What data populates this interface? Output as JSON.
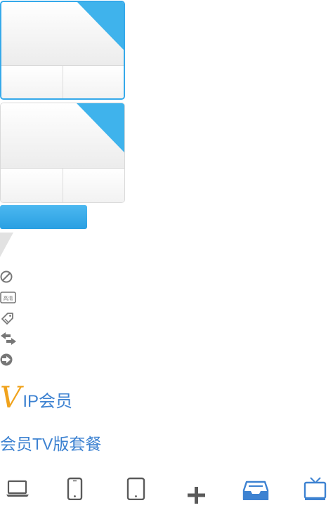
{
  "plans": {
    "cards": [
      {
        "state": "selected"
      },
      {
        "state": "default"
      }
    ],
    "accent_color": "#35a9ea"
  },
  "pay_button": {
    "color": "#2a9fe2"
  },
  "icons": [
    "ban-icon",
    "hd-badge-icon",
    "tag-icon",
    "swap-arrows-icon",
    "arrow-right-circle-icon"
  ],
  "hd_badge_text": "高清",
  "vip": {
    "v_letter": "V",
    "rest": "IP会员",
    "v_color": "#f0a31d",
    "text_color": "#3d82d1"
  },
  "tv_package_title": "会员TV版套餐",
  "devices": [
    "laptop-icon",
    "phone-icon",
    "tablet-icon",
    "plus-icon",
    "tray-icon",
    "tv-icon"
  ]
}
